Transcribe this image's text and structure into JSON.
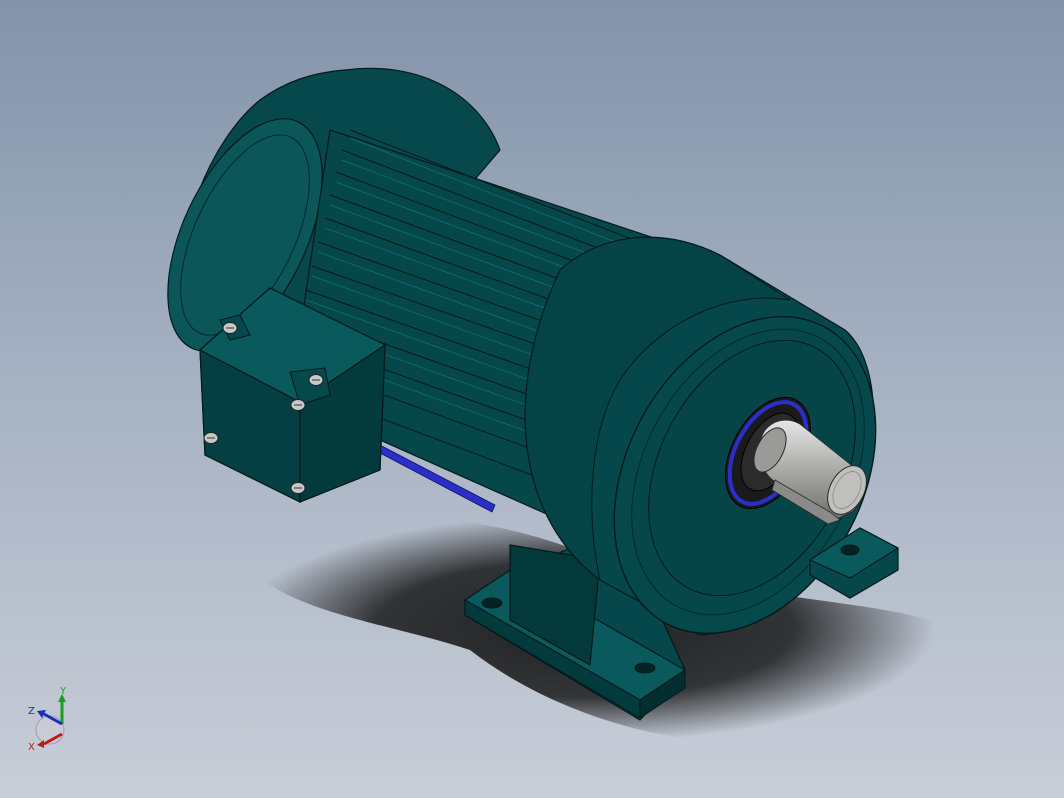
{
  "viewport": {
    "background_top": "#8393aa",
    "background_bottom": "#c8ced8"
  },
  "model": {
    "body_color": "#05474a",
    "shaft_color": "#a9aaa8",
    "seal_color": "#2a2fc9",
    "bolt_color": "#c7c9c8"
  },
  "triad": {
    "x_label": "X",
    "y_label": "Y",
    "z_label": "Z",
    "x_color": "#c01818",
    "y_color": "#19a019",
    "z_color": "#1b2bc0"
  }
}
